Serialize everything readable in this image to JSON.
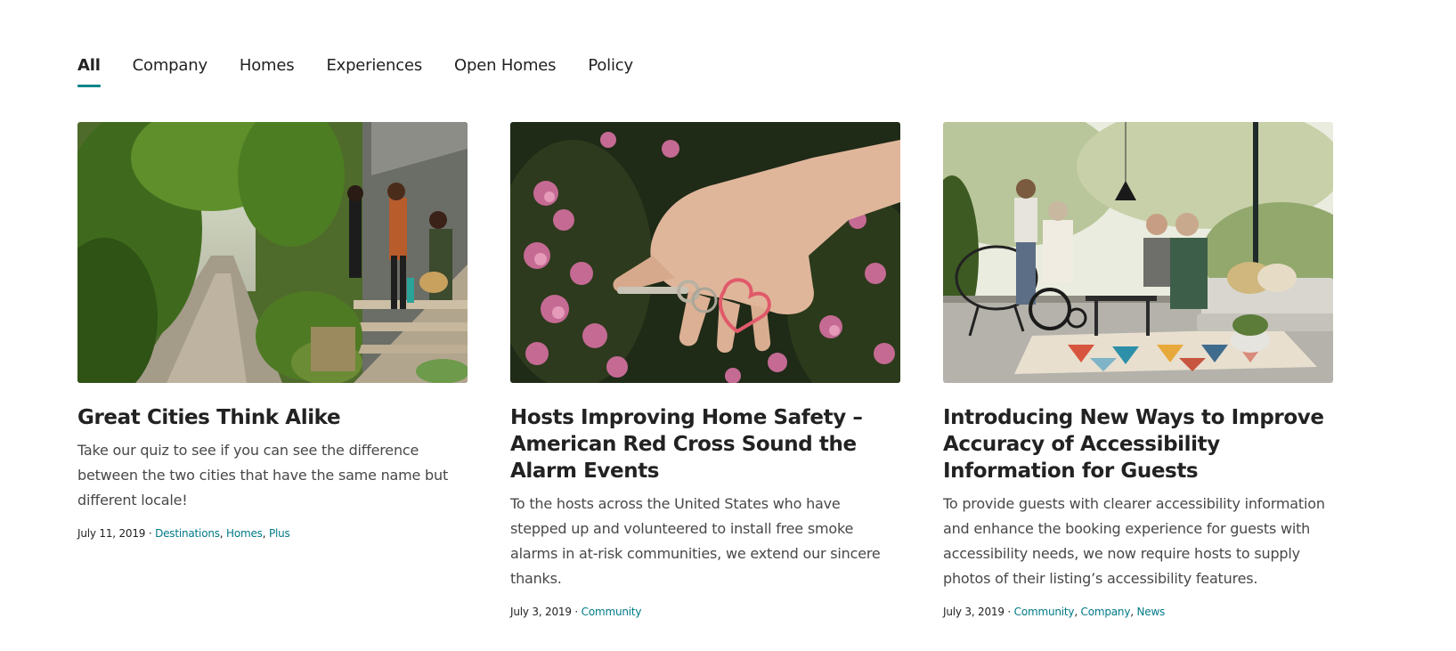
{
  "tabs": [
    {
      "label": "All",
      "active": true
    },
    {
      "label": "Company",
      "active": false
    },
    {
      "label": "Homes",
      "active": false
    },
    {
      "label": "Experiences",
      "active": false
    },
    {
      "label": "Open Homes",
      "active": false
    },
    {
      "label": "Policy",
      "active": false
    }
  ],
  "colors": {
    "accent": "#008489",
    "link": "#007a87",
    "text": "#222222",
    "body_text": "#484848"
  },
  "cards": [
    {
      "image": "garden-stairway-photo",
      "title": "Great Cities Think Alike",
      "description": "Take our quiz to see if you can see the difference between the two cities that have the same name but different locale!",
      "date": "July 11, 2019 · ",
      "tags": [
        "Destinations",
        "Homes",
        "Plus"
      ]
    },
    {
      "image": "hand-holding-keys-photo",
      "title": "Hosts Improving Home Safety – American Red Cross Sound the Alarm Events",
      "description": "To the hosts across the United States who have stepped up and volunteered to install free smoke alarms in at-risk communities, we extend our sincere thanks.",
      "date": "July 3, 2019 · ",
      "tags": [
        "Community"
      ]
    },
    {
      "image": "patio-accessibility-photo",
      "title": "Introducing New Ways to Improve Accuracy of Accessibility Information for Guests",
      "description": "To provide guests with clearer accessibility information and enhance the booking experience for guests with accessibility needs, we now require hosts to supply photos of their listing’s accessibility features.",
      "date": "July 3, 2019 · ",
      "tags": [
        "Community",
        "Company",
        "News"
      ]
    }
  ]
}
